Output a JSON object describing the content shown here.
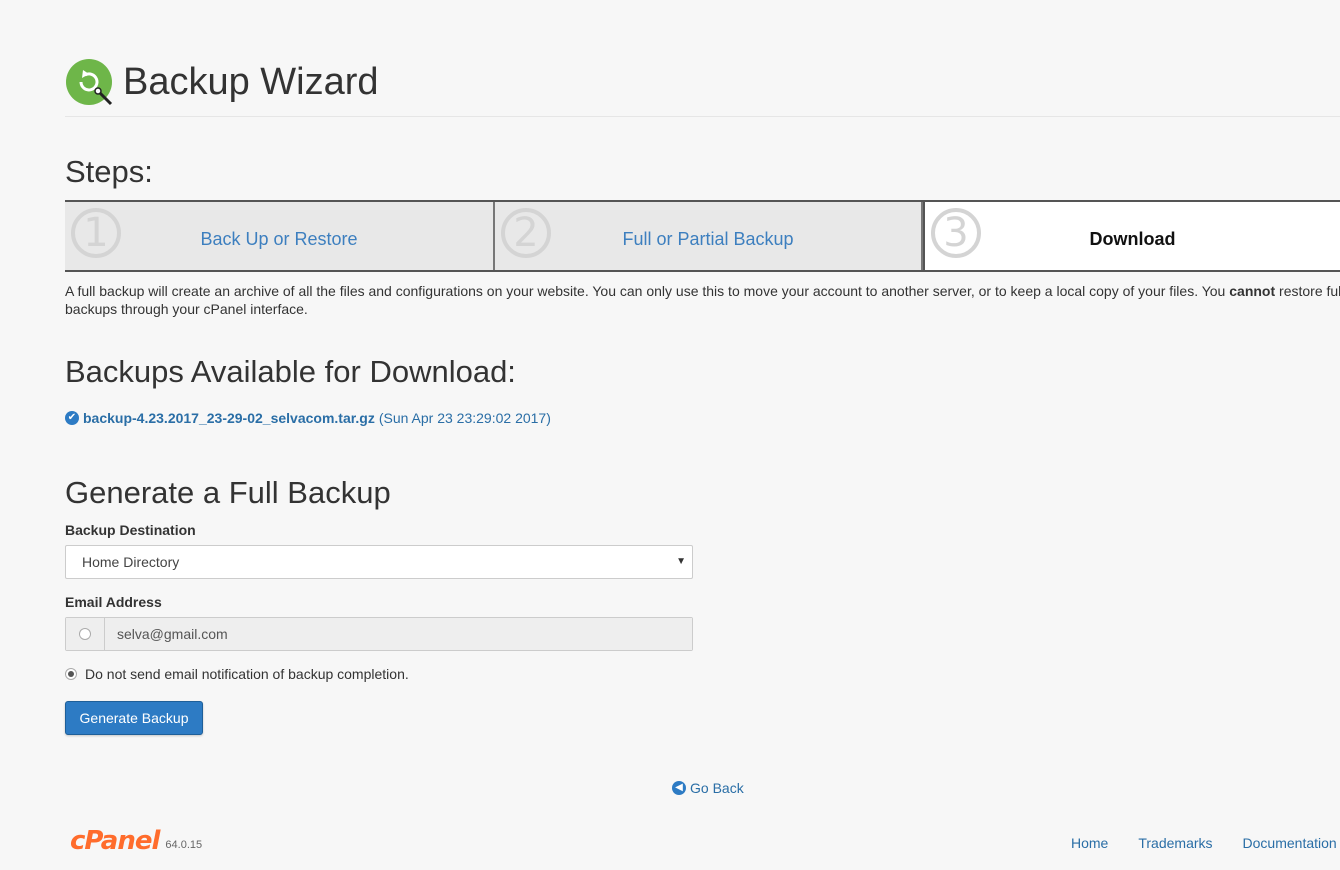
{
  "header": {
    "title": "Backup Wizard",
    "icon": "backup-wizard-icon"
  },
  "steps": {
    "heading": "Steps:",
    "items": [
      {
        "number": "1",
        "label": "Back Up or Restore",
        "state": "done"
      },
      {
        "number": "2",
        "label": "Full or Partial Backup",
        "state": "done"
      },
      {
        "number": "3",
        "label": "Download",
        "state": "current"
      }
    ]
  },
  "intro": {
    "text": "A full backup will create an archive of all the files and configurations on your website. You can only use this to move your account to another server, or to keep a local copy of your files. You ",
    "strong": "cannot",
    "text_after": " restore full backups through your cPanel interface."
  },
  "available": {
    "heading": "Backups Available for Download:",
    "items": [
      {
        "file": "backup-4.23.2017_23-29-02_selvacom.tar.gz",
        "date": "(Sun Apr 23 23:29:02 2017)"
      }
    ]
  },
  "generate": {
    "heading": "Generate a Full Backup",
    "destination_label": "Backup Destination",
    "destination_value": "Home Directory",
    "email_label": "Email Address",
    "email_value": "selva@gmail.com",
    "no_email_label": "Do not send email notification of backup completion.",
    "button_label": "Generate Backup"
  },
  "go_back": "Go Back",
  "footer": {
    "logo": "cPanel",
    "version": "64.0.15",
    "links": [
      "Home",
      "Trademarks",
      "Documentation"
    ]
  },
  "colors": {
    "accent": "#2d7bc4",
    "link": "#2a6ea6",
    "icon_green": "#6eb649",
    "brand_orange": "#ff6c2c"
  }
}
